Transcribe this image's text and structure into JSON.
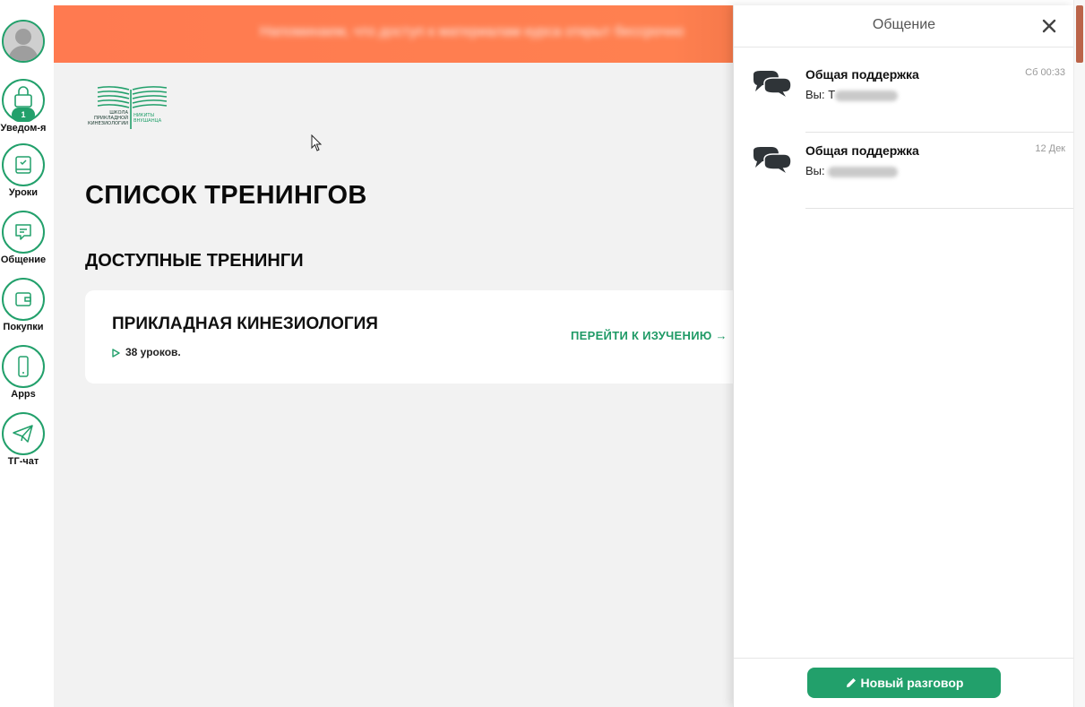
{
  "sidebar": {
    "items": [
      {
        "label": "",
        "icon": "avatar"
      },
      {
        "label": "Уведом-я",
        "icon": "lock-icon",
        "badge": "1"
      },
      {
        "label": "Уроки",
        "icon": "book-icon"
      },
      {
        "label": "Общение",
        "icon": "chat-bubble-icon"
      },
      {
        "label": "Покупки",
        "icon": "wallet-icon"
      },
      {
        "label": "Apps",
        "icon": "phone-icon"
      },
      {
        "label": "ТГ-чат",
        "icon": "telegram-icon"
      }
    ]
  },
  "banner": {
    "text": "Напоминаем, что доступ к материалам курса открыт бессрочно"
  },
  "logo": {
    "line1": "ШКОЛА",
    "line2": "ПРИКЛАДНОЙ",
    "line3": "КИНЕЗИОЛОГИИ",
    "line4": "НИКИТЫ",
    "line5": "ВНУШАНЦА"
  },
  "main": {
    "page_title": "СПИСОК ТРЕНИНГОВ",
    "section_title": "ДОСТУПНЫЕ ТРЕНИНГИ",
    "trainings": [
      {
        "title": "ПРИКЛАДНАЯ КИНЕЗИОЛОГИЯ",
        "lessons": "38 уроков.",
        "link": "ПЕРЕЙТИ К ИЗУЧЕНИЮ →"
      }
    ]
  },
  "panel": {
    "title": "Общение",
    "conversations": [
      {
        "name": "Общая поддержка",
        "preview_prefix": "Вы: Т",
        "time": "Сб 00:33"
      },
      {
        "name": "Общая поддержка",
        "preview_prefix": "Вы: ",
        "time": "12 Дек"
      }
    ],
    "new_button": "Новый разговор"
  },
  "colors": {
    "accent": "#22a06b",
    "banner": "#ff7a50",
    "background": "#f2f2f2"
  }
}
